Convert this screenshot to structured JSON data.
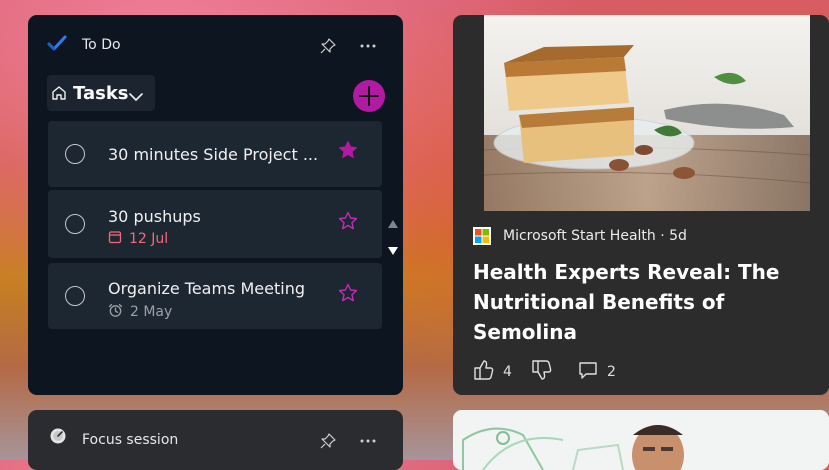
{
  "todo_widget": {
    "title": "To Do",
    "list_name": "Tasks",
    "tasks": [
      {
        "title": "30 minutes Side Project ...",
        "detail": "",
        "detail_icon": "",
        "starred": true
      },
      {
        "title": "30 pushups",
        "detail": "12 Jul",
        "detail_icon": "calendar-icon",
        "starred": false
      },
      {
        "title": "Organize Teams Meeting",
        "detail": "2 May",
        "detail_icon": "alarm-icon",
        "starred": false
      }
    ]
  },
  "news_card": {
    "source": "Microsoft Start Health · 5d",
    "headline": "Health Experts Reveal: The Nutritional Benefits of Semolina",
    "likes": "4",
    "comments": "2"
  },
  "focus_widget": {
    "title": "Focus session"
  },
  "colors": {
    "accent": "#b31aa4",
    "due_date": "#f06a79",
    "todo_check": "#2f7bf0"
  }
}
